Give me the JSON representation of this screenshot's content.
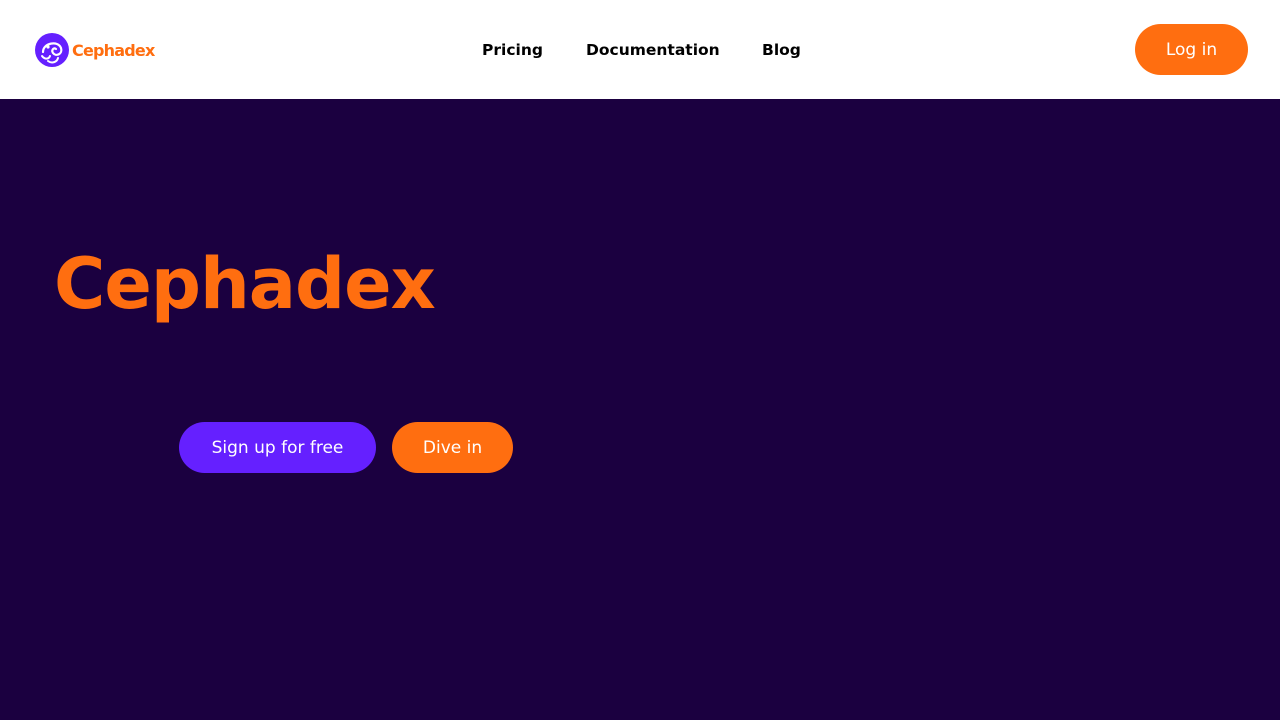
{
  "brand": {
    "name": "Cephadex",
    "logo_icon": "octopus-logo-icon",
    "primary_color": "#ff6e10",
    "accent_color": "#6520ff",
    "background_color": "#1b0040"
  },
  "nav": {
    "items": [
      {
        "label": "Pricing"
      },
      {
        "label": "Documentation"
      },
      {
        "label": "Blog"
      }
    ],
    "login_label": "Log in"
  },
  "hero": {
    "title": "Cephadex",
    "signup_label": "Sign up for free",
    "dive_label": "Dive in"
  }
}
